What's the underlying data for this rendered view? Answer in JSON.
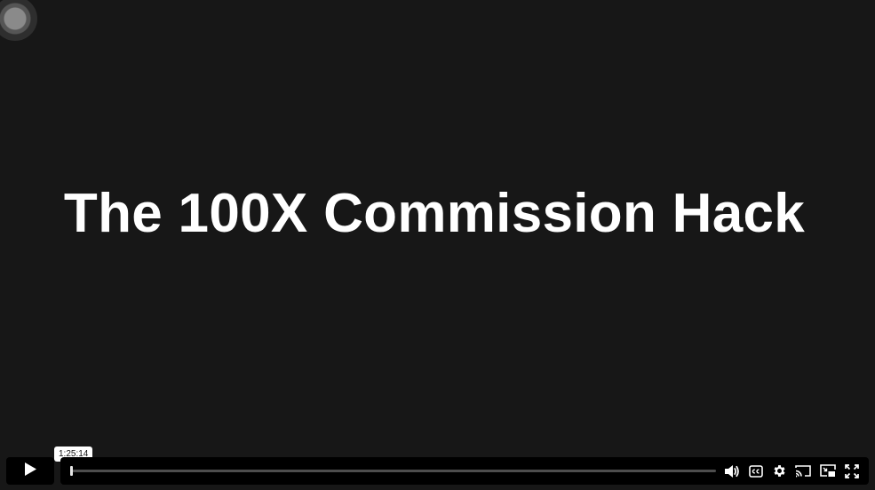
{
  "video": {
    "title": "The 100X Commission Hack"
  },
  "player": {
    "hover_time": "1:25:14",
    "progress_fraction": 0.0,
    "accent_color": "#ffffff",
    "bar_color": "#000000",
    "background_color": "#171717"
  },
  "controls": {
    "play": {
      "icon": "play-icon"
    },
    "volume": {
      "icon": "volume-icon"
    },
    "captions": {
      "icon": "closed-captions-icon",
      "label": "CC"
    },
    "settings": {
      "icon": "gear-icon"
    },
    "cast": {
      "icon": "cast-icon"
    },
    "pip": {
      "icon": "picture-in-picture-icon"
    },
    "fullscreen": {
      "icon": "fullscreen-icon"
    }
  }
}
